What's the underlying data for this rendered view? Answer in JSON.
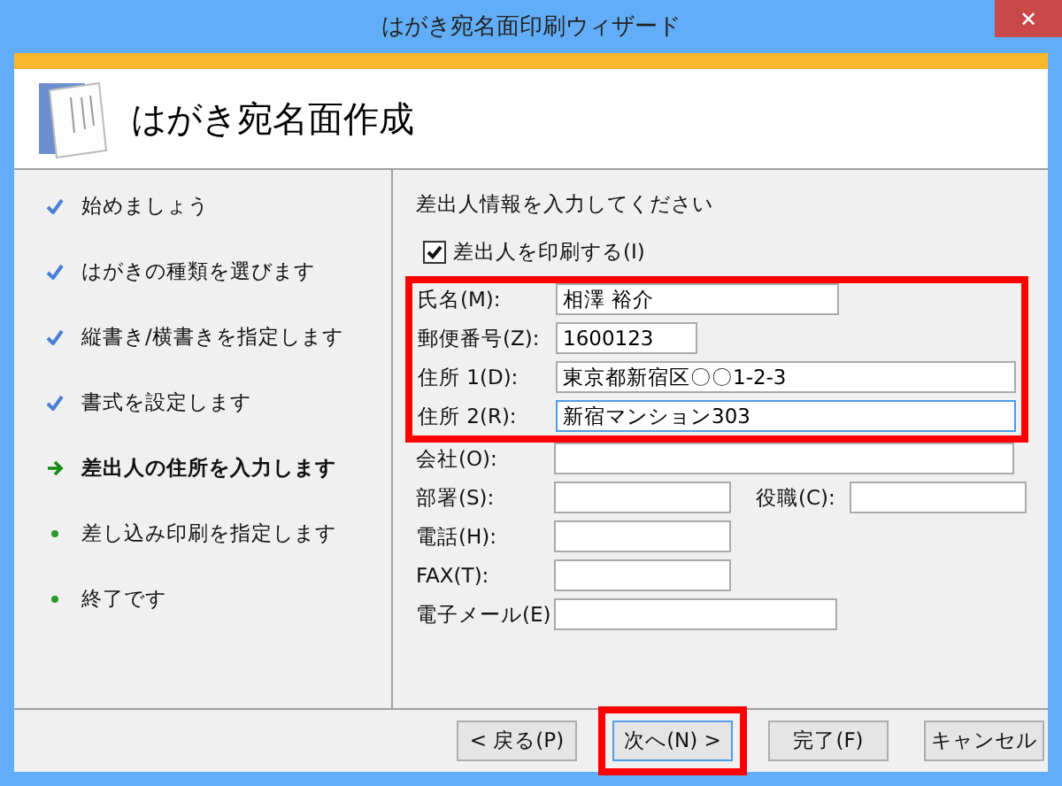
{
  "window": {
    "title": "はがき宛名面印刷ウィザード",
    "close": "✕"
  },
  "header": {
    "title": "はがき宛名面作成"
  },
  "steps": [
    {
      "label": "始めましょう",
      "kind": "done"
    },
    {
      "label": "はがきの種類を選びます",
      "kind": "done"
    },
    {
      "label": "縦書き/横書きを指定します",
      "kind": "done"
    },
    {
      "label": "書式を設定します",
      "kind": "done"
    },
    {
      "label": "差出人の住所を入力します",
      "kind": "current"
    },
    {
      "label": "差し込み印刷を指定します",
      "kind": "pending"
    },
    {
      "label": "終了です",
      "kind": "pending"
    }
  ],
  "form": {
    "instruction": "差出人情報を入力してください",
    "print_sender": {
      "label": "差出人を印刷する(I)",
      "checked": true
    },
    "highlighted_fields": [
      {
        "label": "氏名(M):",
        "value": "相澤 裕介",
        "focused": false
      },
      {
        "label": "郵便番号(Z):",
        "value": "1600123",
        "focused": false
      },
      {
        "label": "住所 1(D):",
        "value": "東京都新宿区〇〇1-2-3",
        "focused": false
      },
      {
        "label": "住所 2(R):",
        "value": "新宿マンション303",
        "focused": true
      }
    ],
    "other_fields": [
      {
        "label": "会社(O):",
        "focused": false
      },
      {
        "label": "部署(S):",
        "focused": false,
        "extra": {
          "label": "役職(C):"
        }
      },
      {
        "label": "電話(H):",
        "focused": false
      },
      {
        "label": "FAX(T):",
        "focused": false
      },
      {
        "label": "電子メール(E)",
        "focused": false
      }
    ]
  },
  "buttons": [
    {
      "label": "< 戻る(P)",
      "highlighted": false,
      "focused": false
    },
    {
      "label": "次へ(N) >",
      "highlighted": true,
      "focused": true
    },
    {
      "label": "完了(F)",
      "highlighted": false,
      "focused": false
    },
    {
      "label": "キャンセル",
      "highlighted": false,
      "focused": false
    }
  ]
}
